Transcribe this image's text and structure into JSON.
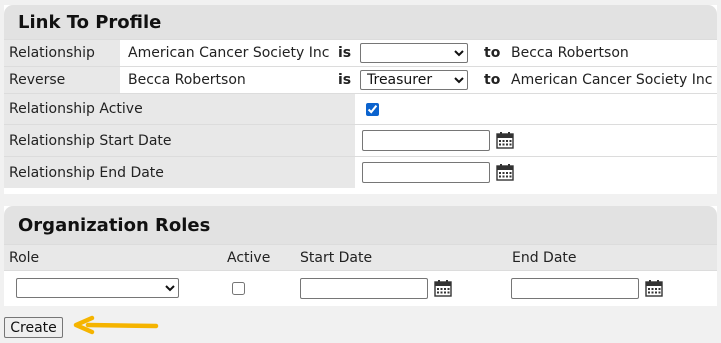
{
  "link_profile": {
    "title": "Link To Profile",
    "relationship": {
      "label": "Relationship",
      "from": "American Cancer Society Inc",
      "is_word": "is",
      "type_value": "",
      "to_word": "to",
      "to": "Becca Robertson"
    },
    "reverse": {
      "label": "Reverse",
      "from": "Becca Robertson",
      "is_word": "is",
      "type_value": "Treasurer",
      "to_word": "to",
      "to": "American Cancer Society Inc"
    },
    "active": {
      "label": "Relationship Active",
      "checked": true
    },
    "start_date": {
      "label": "Relationship Start Date",
      "value": ""
    },
    "end_date": {
      "label": "Relationship End Date",
      "value": ""
    }
  },
  "org_roles": {
    "title": "Organization Roles",
    "columns": {
      "role": "Role",
      "active": "Active",
      "start": "Start Date",
      "end": "End Date"
    },
    "row": {
      "role": "",
      "active": false,
      "start": "",
      "end": ""
    }
  },
  "create_label": "Create",
  "icons": {
    "calendar": "calendar-icon",
    "arrow": "arrow-left-icon"
  },
  "colors": {
    "arrow": "#f5b400",
    "checkbox": "#0b63ce"
  }
}
